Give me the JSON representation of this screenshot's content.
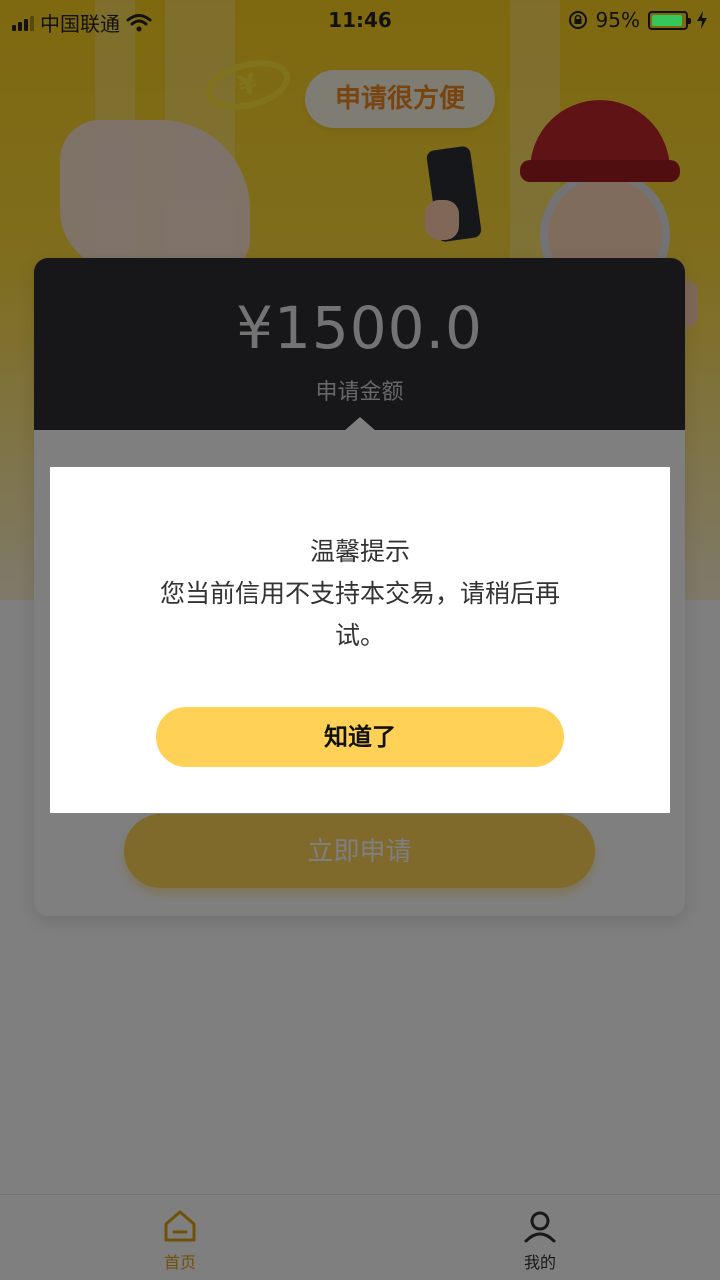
{
  "status_bar": {
    "carrier": "中国联通",
    "time": "11:46",
    "battery_percent": "95%",
    "battery_level": 0.95,
    "battery_color": "#35c759"
  },
  "hero": {
    "badge": "申请很方便",
    "coin_symbol": "¥"
  },
  "loan_card": {
    "amount": "¥1500.0",
    "amount_label": "申请金额",
    "apply_button": "立即申请"
  },
  "dialog": {
    "title": "温馨提示",
    "message": "您当前信用不支持本交易，请稍后再试。",
    "confirm_button": "知道了"
  },
  "tabbar": {
    "tabs": [
      {
        "label": "首页",
        "icon": "home-icon",
        "active": true
      },
      {
        "label": "我的",
        "icon": "profile-icon",
        "active": false
      }
    ]
  },
  "colors": {
    "accent": "#ffd257",
    "active_tab": "#e0a214",
    "hero_yellow": "#ffd21f",
    "amount_panel": "#2f2f33",
    "overlay": "rgba(0,0,0,0.5)"
  }
}
